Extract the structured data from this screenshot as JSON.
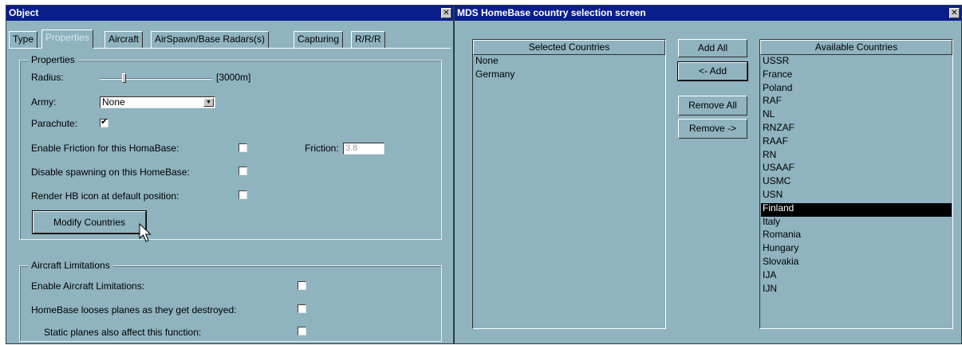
{
  "object_window": {
    "title": "Object",
    "close_glyph": "✕",
    "tabs": [
      {
        "label": "Type",
        "active": false
      },
      {
        "label": "Properties",
        "active": true
      },
      {
        "label": "Aircraft",
        "active": false
      },
      {
        "label": "AirSpawn/Base Radars(s)",
        "active": false
      },
      {
        "label": "Capturing",
        "active": false
      },
      {
        "label": "R/R/R",
        "active": false
      }
    ],
    "properties": {
      "legend": "Properties",
      "radius_label": "Radius:",
      "radius_value": "[3000m]",
      "radius_slider_fraction": 0.22,
      "army_label": "Army:",
      "army_value": "None",
      "parachute_label": "Parachute:",
      "parachute_checked": true,
      "friction_enable_label": "Enable Friction for this HomaBase:",
      "friction_enable_checked": false,
      "friction_label": "Friction:",
      "friction_value": "3.8",
      "disable_spawning_label": "Disable spawning on this HomeBase:",
      "disable_spawning_checked": false,
      "render_icon_label": "Render HB icon at default position:",
      "render_icon_checked": false,
      "modify_countries_label": "Modify Countries"
    },
    "aircraft_limitations": {
      "legend": "Aircraft Limitations",
      "enable_label": "Enable Aircraft Limitations:",
      "enable_checked": false,
      "looses_label": "HomeBase looses planes as they get destroyed:",
      "looses_checked": false,
      "static_label": "Static planes also affect this function:",
      "static_checked": false
    }
  },
  "mds_window": {
    "title": "MDS HomeBase country selection screen",
    "close_glyph": "✕",
    "selected_header": "Selected Countries",
    "selected_countries": [
      "None",
      "Germany"
    ],
    "available_header": "Available Countries",
    "available_countries": [
      "USSR",
      "France",
      "Poland",
      "RAF",
      "NL",
      "RNZAF",
      "RAAF",
      "RN",
      "USAAF",
      "USMC",
      "USN",
      "Finland",
      "Italy",
      "Romania",
      "Hungary",
      "Slovakia",
      "IJA",
      "IJN"
    ],
    "available_selected_index": 11,
    "buttons": {
      "add_all": "Add All",
      "add": "<- Add",
      "remove_all": "Remove All",
      "remove": "Remove ->"
    }
  }
}
